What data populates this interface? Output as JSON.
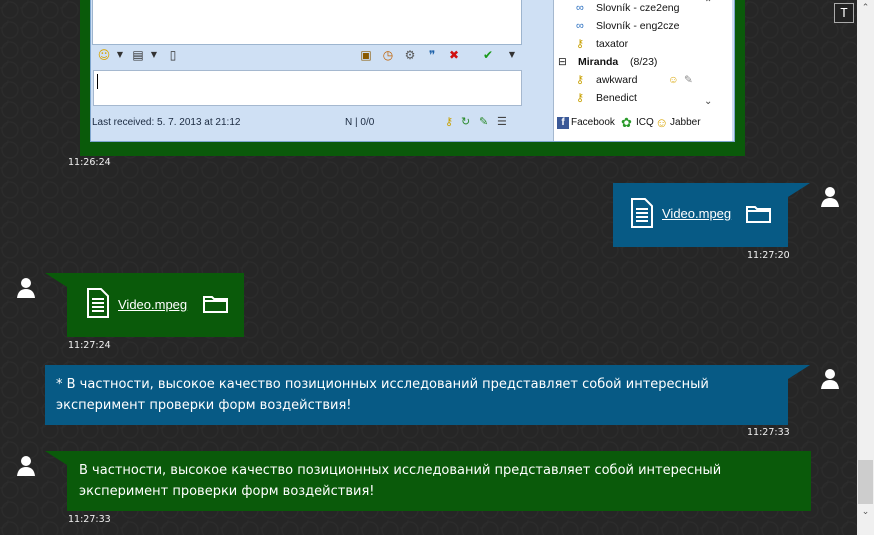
{
  "screenshot": {
    "status_received": "Last received: 5. 7. 2013 at 21:12",
    "status_mode": "N | 0/0",
    "contacts": [
      {
        "name": "Slovník - cze2eng",
        "icon": "dictionary-icon"
      },
      {
        "name": "Slovník - eng2cze",
        "icon": "dictionary-icon"
      },
      {
        "name": "taxator",
        "icon": "key-icon"
      }
    ],
    "group": {
      "name": "Miranda",
      "count": "(8/23)",
      "toggle": "⊟"
    },
    "group_contacts": [
      {
        "name": "awkward",
        "icon": "key-icon"
      },
      {
        "name": "Benedict",
        "icon": "key-icon"
      }
    ],
    "protocols": [
      "Facebook",
      "ICQ",
      "Jabber"
    ]
  },
  "messages": [
    {
      "time": "11:26:24"
    },
    {
      "file": "Video.mpeg",
      "time": "11:27:20"
    },
    {
      "file": "Video.mpeg",
      "time": "11:27:24"
    },
    {
      "text": "* В частности, высокое качество позиционных исследований представляет собой интересный эксперимент проверки форм воздействия!",
      "time": "11:27:33"
    },
    {
      "text": "В частности, высокое качество позиционных исследований представляет собой интересный эксперимент проверки форм воздействия!",
      "time": "11:27:33"
    }
  ],
  "tool_button": "T",
  "colors": {
    "outgoing": "#075a85",
    "incoming": "#0a5a0a",
    "background": "#262626"
  }
}
